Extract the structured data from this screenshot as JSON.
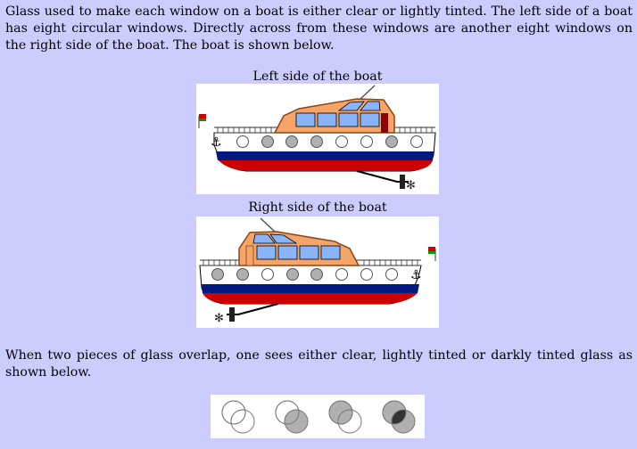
{
  "intro_text": "Glass used to make each window on a boat is either clear or lightly tinted. The left side of a boat has eight circular windows. Directly across from these windows are another eight windows on the right side of the boat. The boat is shown below.",
  "caption_left": "Left side of the boat",
  "caption_right": "Right side of the boat",
  "overlap_text": "When two pieces of glass overlap, one sees either clear, lightly tinted or darkly tinted glass as shown below.",
  "colors": {
    "background": "#ccccff",
    "hull_navy": "#001a80",
    "hull_red": "#cc0000",
    "cabin": "#f5a56a",
    "cabin_window": "#8ab4f8",
    "clear_glass": "#ffffff",
    "tinted_glass": "#b0b0b0",
    "dark_glass": "#333333"
  },
  "left_side_windows": [
    "clear",
    "tinted",
    "tinted",
    "tinted",
    "clear",
    "clear",
    "tinted",
    "clear"
  ],
  "right_side_windows": [
    "tinted",
    "tinted",
    "clear",
    "tinted",
    "tinted",
    "clear",
    "clear",
    "clear"
  ],
  "overlap_examples": [
    {
      "left": "clear",
      "right": "clear",
      "overlap": "clear"
    },
    {
      "left": "clear",
      "right": "tinted",
      "overlap": "lightly-tinted"
    },
    {
      "left": "tinted",
      "right": "clear",
      "overlap": "lightly-tinted"
    },
    {
      "left": "tinted",
      "right": "tinted",
      "overlap": "darkly-tinted"
    }
  ]
}
